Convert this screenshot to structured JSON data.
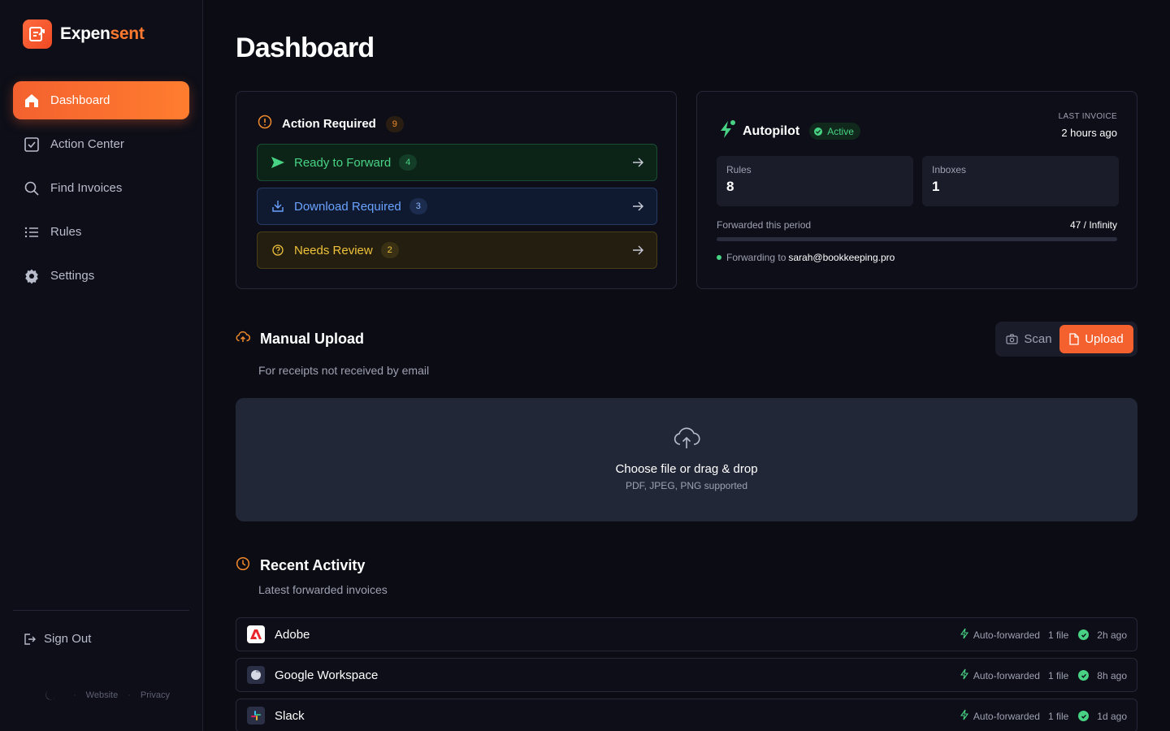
{
  "brand": {
    "name_part1": "Expen",
    "name_part2": "sent"
  },
  "sidebar": {
    "items": [
      {
        "label": "Dashboard",
        "icon": "home-icon",
        "active": true
      },
      {
        "label": "Action Center",
        "icon": "checkbox-icon"
      },
      {
        "label": "Find Invoices",
        "icon": "search-icon"
      },
      {
        "label": "Rules",
        "icon": "list-icon"
      },
      {
        "label": "Settings",
        "icon": "gear-icon"
      }
    ],
    "sign_out": "Sign Out",
    "footer": {
      "website": "Website",
      "privacy": "Privacy",
      "theme_icon": "moon-icon"
    }
  },
  "page": {
    "title": "Dashboard"
  },
  "action_required": {
    "title": "Action Required",
    "count": "9",
    "rows": [
      {
        "label": "Ready to Forward",
        "count": "4",
        "icon": "send-icon",
        "color": "#48d384"
      },
      {
        "label": "Download Required",
        "count": "3",
        "icon": "download-icon",
        "color": "#6aa2ff"
      },
      {
        "label": "Needs Review",
        "count": "2",
        "icon": "question-icon",
        "color": "#f0c23a"
      }
    ]
  },
  "autopilot": {
    "title": "Autopilot",
    "status": "Active",
    "last_invoice_label": "LAST INVOICE",
    "last_invoice_value": "2 hours ago",
    "rules_label": "Rules",
    "rules_value": "8",
    "inboxes_label": "Inboxes",
    "inboxes_value": "1",
    "forwarded_label": "Forwarded this period",
    "forwarded_value": "47 / Infinity",
    "forwarding_to_label": "Forwarding to",
    "forwarding_to_email": "sarah@bookkeeping.pro"
  },
  "manual_upload": {
    "title": "Manual Upload",
    "subtitle": "For receipts not received by email",
    "scan_label": "Scan",
    "upload_label": "Upload",
    "drop_title": "Choose file or drag & drop",
    "drop_sub": "PDF, JPEG, PNG supported"
  },
  "recent_activity": {
    "title": "Recent Activity",
    "subtitle": "Latest forwarded invoices",
    "rows": [
      {
        "vendor": "Adobe",
        "status": "Auto-forwarded",
        "files": "1 file",
        "time": "2h ago"
      },
      {
        "vendor": "Google Workspace",
        "status": "Auto-forwarded",
        "files": "1 file",
        "time": "8h ago"
      },
      {
        "vendor": "Slack",
        "status": "Auto-forwarded",
        "files": "1 file",
        "time": "1d ago"
      }
    ]
  },
  "colors": {
    "accent": "#f4612f",
    "success": "#48d384",
    "info": "#6aa2ff",
    "warning": "#f0c23a",
    "background": "#0b0c14"
  }
}
